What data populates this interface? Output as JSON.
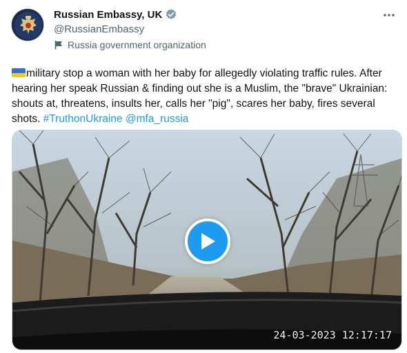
{
  "account": {
    "display_name": "Russian Embassy, UK",
    "handle": "@RussianEmbassy",
    "label": "Russia government organization",
    "verified_color": "#829aab"
  },
  "tweet": {
    "text_main": "military stop a woman with her baby for allegedly violating traffic rules. After hearing her speak Russian & finding out she is a Muslim, the \"brave\" Ukrainian: shouts at, threatens, insults her, calls her \"pig\", scares her baby, fires several shots.",
    "hashtag": "#TruthonUkraine",
    "mention": "@mfa_russia",
    "link_color": "#1d9bf0"
  },
  "media": {
    "timestamp": "24-03-2023 12:17:17",
    "play_icon": "play-icon"
  },
  "icons": {
    "more": "more-icon",
    "verified": "verified-badge-icon",
    "gov": "flag-icon"
  }
}
